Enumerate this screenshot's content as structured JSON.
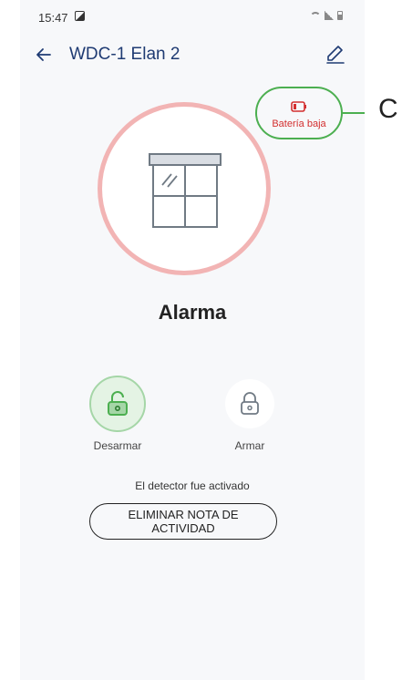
{
  "status_bar": {
    "time": "15:47"
  },
  "header": {
    "title": "WDC-1 Elan 2"
  },
  "battery_status": {
    "label": "Batería baja",
    "color": "#d32f2f"
  },
  "callout": {
    "letter": "C"
  },
  "sensor": {
    "state": "Alarma",
    "ring_color": "#f2b4b4"
  },
  "actions": [
    {
      "label": "Desarmar",
      "selected": true
    },
    {
      "label": "Armar",
      "selected": false
    }
  ],
  "activity": {
    "message": "El detector fue activado",
    "button_line1": "ELIMINAR NOTA DE",
    "button_line2": "ACTIVIDAD"
  },
  "colors": {
    "primary": "#1f3b73",
    "accent_green": "#4caf50",
    "alert_red": "#d32f2f"
  }
}
